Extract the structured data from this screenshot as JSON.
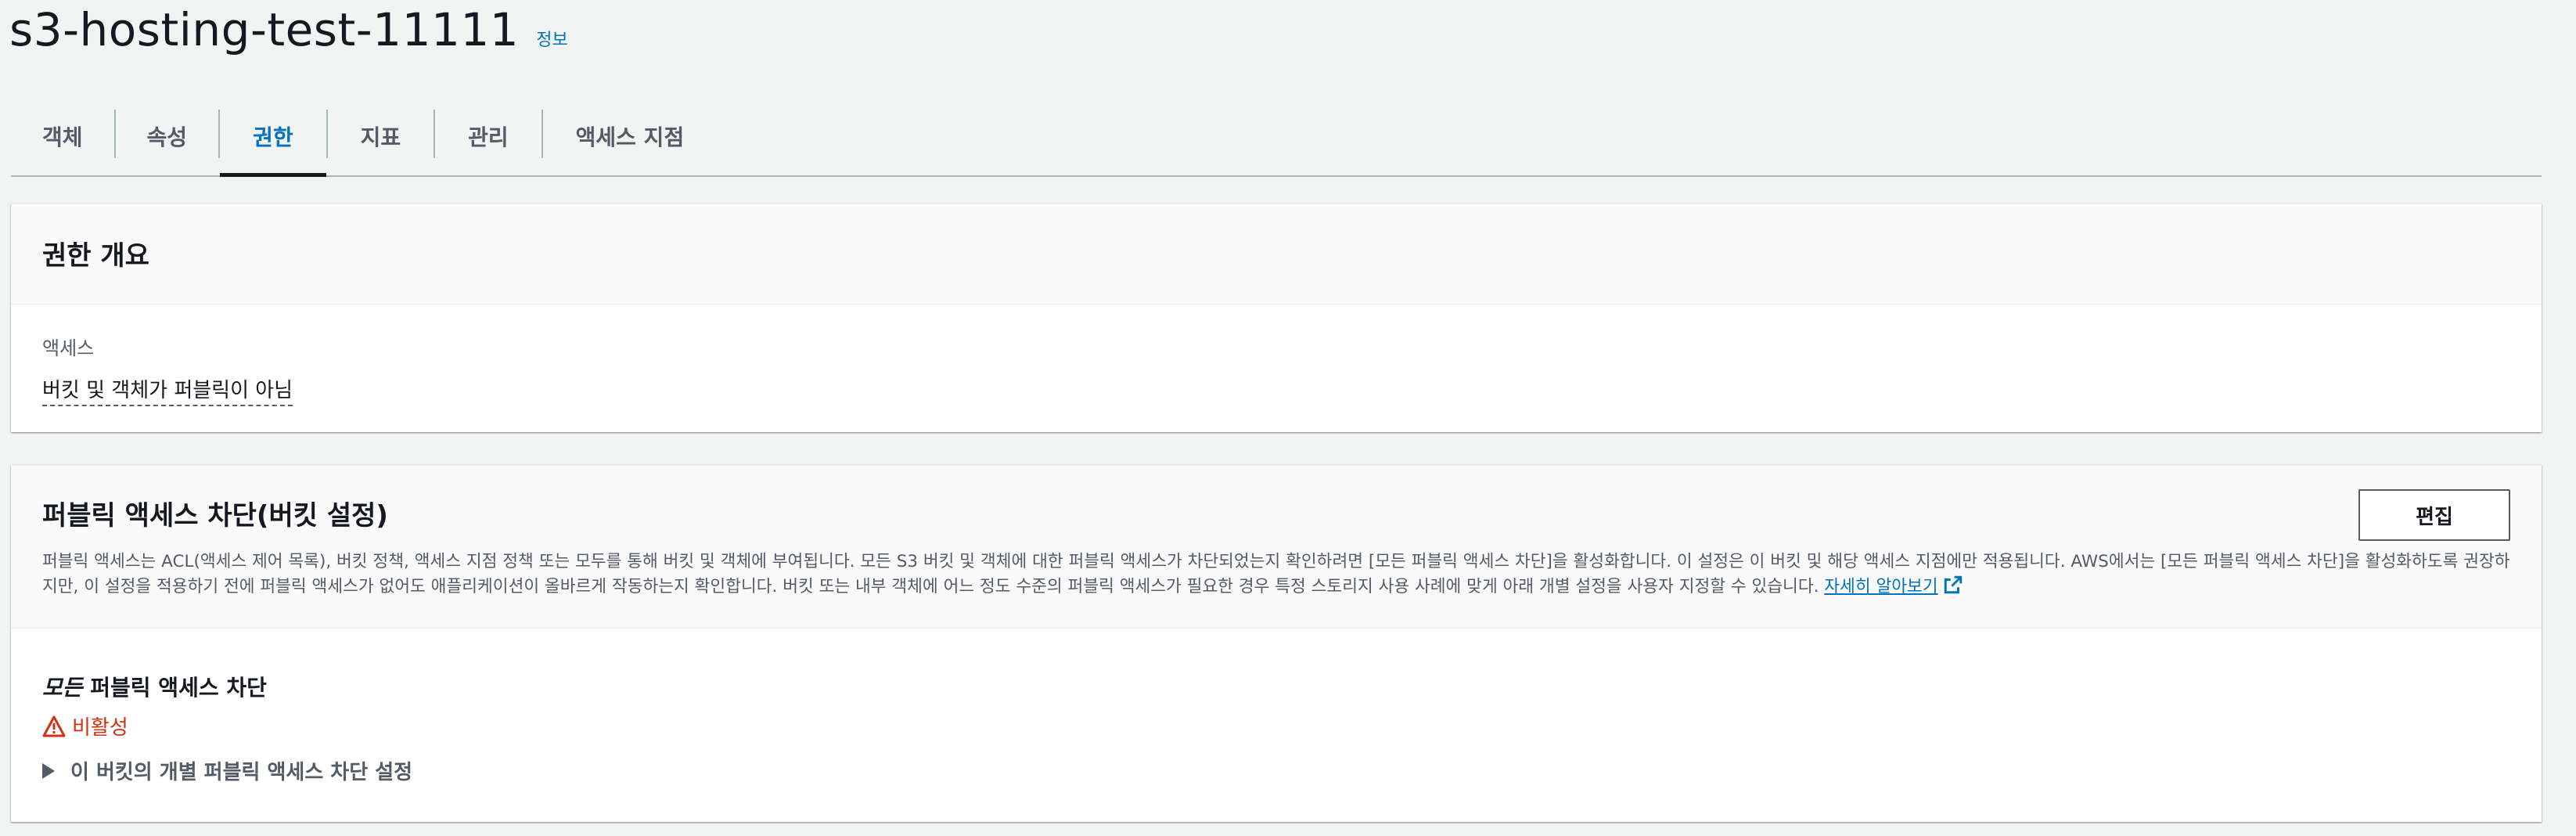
{
  "header": {
    "title": "s3-hosting-test-11111",
    "info_link": "정보"
  },
  "tabs": [
    {
      "label": "객체"
    },
    {
      "label": "속성"
    },
    {
      "label": "권한"
    },
    {
      "label": "지표"
    },
    {
      "label": "관리"
    },
    {
      "label": "액세스 지점"
    }
  ],
  "active_tab": "권한",
  "overview": {
    "title": "권한 개요",
    "access_label": "액세스",
    "access_value": "버킷 및 객체가 퍼블릭이 아님"
  },
  "block_public_access": {
    "title": "퍼블릭 액세스 차단(버킷 설정)",
    "edit_label": "편집",
    "description": "퍼블릭 액세스는 ACL(액세스 제어 목록), 버킷 정책, 액세스 지점 정책 또는 모두를 통해 버킷 및 객체에 부여됩니다. 모든 S3 버킷 및 객체에 대한 퍼블릭 액세스가 차단되었는지 확인하려면 [모든 퍼블릭 액세스 차단]을 활성화합니다. 이 설정은 이 버킷 및 해당 액세스 지점에만 적용됩니다. AWS에서는 [모든 퍼블릭 액세스 차단]을 활성화하도록 권장하지만, 이 설정을 적용하기 전에 퍼블릭 액세스가 없어도 애플리케이션이 올바르게 작동하는지 확인합니다. 버킷 또는 내부 객체에 어느 정도 수준의 퍼블릭 액세스가 필요한 경우 특정 스토리지 사용 사례에 맞게 아래 개별 설정을 사용자 지정할 수 있습니다.",
    "learn_more": "자세히 알아보기",
    "setting_title_em": "모든",
    "setting_title_rest": " 퍼블릭 액세스 차단",
    "status": "비활성",
    "expander_label": "이 버킷의 개별 퍼블릭 액세스 차단 설정"
  },
  "colors": {
    "link": "#0073bb",
    "warning": "#d13212",
    "active_tab_indicator": "#16191f"
  },
  "icons": {
    "status": "warning-icon",
    "learn_more": "external-link-icon",
    "expander": "caret-right-icon"
  }
}
